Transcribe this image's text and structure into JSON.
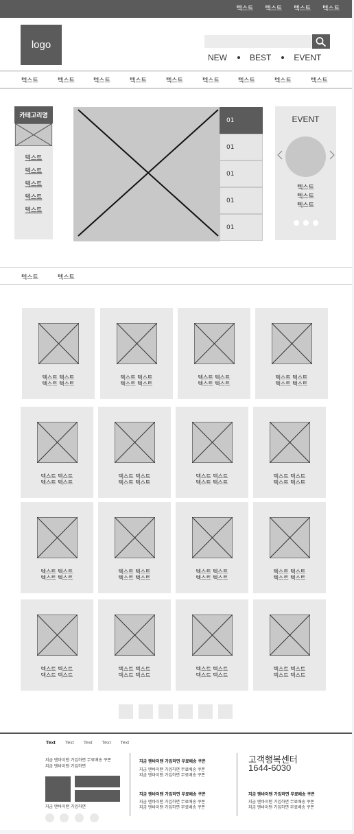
{
  "top_links": [
    "텍스트",
    "텍스트",
    "텍스트",
    "텍스트"
  ],
  "logo": "logo",
  "search": {
    "placeholder": ""
  },
  "quick_links": [
    "NEW",
    "BEST",
    "EVENT"
  ],
  "gnb": [
    "텍스트",
    "텍스트",
    "텍스트",
    "텍스트",
    "텍스트",
    "텍스트",
    "텍스트",
    "텍스트",
    "텍스트"
  ],
  "category": {
    "title": "카테고리명",
    "links": [
      "텍스트",
      "텍스트",
      "텍스트",
      "텍스트",
      "텍스트"
    ]
  },
  "banner_tabs": [
    "01",
    "01",
    "01",
    "01",
    "01"
  ],
  "event": {
    "title": "EVENT",
    "links": [
      "텍스트",
      "텍스트",
      "텍스트"
    ]
  },
  "sub_nav": [
    "텍스트",
    "텍스트"
  ],
  "products": [
    {
      "line1": "텍스트 텍스트",
      "line2": "텍스트 텍스트"
    },
    {
      "line1": "텍스트 텍스트",
      "line2": "텍스트 텍스트"
    },
    {
      "line1": "텍스트 텍스트",
      "line2": "텍스트 텍스트"
    },
    {
      "line1": "텍스트 텍스트",
      "line2": "텍스트 텍스트"
    },
    {
      "line1": "텍스트 텍스트",
      "line2": "텍스트 텍스트"
    },
    {
      "line1": "텍스트 텍스트",
      "line2": "텍스트 텍스트"
    },
    {
      "line1": "텍스트 텍스트",
      "line2": "텍스트 텍스트"
    },
    {
      "line1": "텍스트 텍스트",
      "line2": "텍스트 텍스트"
    },
    {
      "line1": "텍스트 텍스트",
      "line2": "텍스트 텍스트"
    },
    {
      "line1": "텍스트 텍스트",
      "line2": "텍스트 텍스트"
    },
    {
      "line1": "텍스트 텍스트",
      "line2": "텍스트 텍스트"
    },
    {
      "line1": "텍스트 텍스트",
      "line2": "텍스트 텍스트"
    },
    {
      "line1": "텍스트 텍스트",
      "line2": "텍스트 텍스트"
    },
    {
      "line1": "텍스트 텍스트",
      "line2": "텍스트 텍스트"
    },
    {
      "line1": "텍스트 텍스트",
      "line2": "텍스트 텍스트"
    },
    {
      "line1": "텍스트 텍스트",
      "line2": "텍스트 텍스트"
    }
  ],
  "footer": {
    "tabs": [
      "Text",
      "Text",
      "Text",
      "Text",
      "Text"
    ],
    "col1_lines": [
      "지금 탠바이탠 가입하면 무료배송 쿠폰",
      "지금 탠바이탠 가입하면"
    ],
    "col1_bottom": "지금 탠바이탠 가입하면",
    "col2_title1": "지금 탠바이탠 가입하면 무료배송 쿠폰",
    "col2_lines1": [
      "지금 탠바이탠 가입하면 무료배송 쿠폰",
      "지금 탠바이탠 가입하면 무료배송 쿠폰"
    ],
    "col2_title2": "지금 탠바이탠 가입하면 무료배송 쿠폰",
    "col2_lines2": [
      "지금 탠바이탠 가입하면 무료배송 쿠폰",
      "지금 탠바이탠 가입하면 무료배송 쿠폰"
    ],
    "cs_title": "고객행복센터",
    "cs_phone": "1644-6030",
    "col3_title": "지금 탠바이탠 가입하면 무료배송 쿠폰",
    "col3_lines": [
      "지금 탠바이탠 가입하면 무료배송 쿠폰",
      "지금 탠바이탠 가입하면 무료배송 쿠폰"
    ]
  }
}
